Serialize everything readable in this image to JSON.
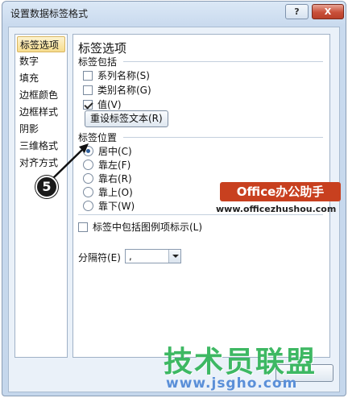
{
  "window": {
    "title": "设置数据标签格式",
    "help_label": "?",
    "close_label": "X"
  },
  "nav": {
    "items": [
      {
        "label": "标签选项",
        "selected": true
      },
      {
        "label": "数字"
      },
      {
        "label": "填充"
      },
      {
        "label": "边框颜色"
      },
      {
        "label": "边框样式"
      },
      {
        "label": "阴影"
      },
      {
        "label": "三维格式"
      },
      {
        "label": "对齐方式"
      }
    ]
  },
  "panel": {
    "title": "标签选项",
    "label_contains": {
      "heading": "标签包括",
      "options": [
        {
          "label": "系列名称(S)",
          "checked": false
        },
        {
          "label": "类别名称(G)",
          "checked": false
        },
        {
          "label": "值(V)",
          "checked": true
        }
      ],
      "reset_button": "重设标签文本(R)"
    },
    "label_position": {
      "heading": "标签位置",
      "options": [
        {
          "label": "居中(C)",
          "checked": true
        },
        {
          "label": "靠左(F)",
          "checked": false
        },
        {
          "label": "靠右(R)",
          "checked": false
        },
        {
          "label": "靠上(O)",
          "checked": false
        },
        {
          "label": "靠下(W)",
          "checked": false
        }
      ]
    },
    "include_legend_key": {
      "label": "标签中包括图例项标示(L)",
      "checked": false
    },
    "separator": {
      "label": "分隔符(E)",
      "value": ","
    }
  },
  "annotation": {
    "step_number": "5"
  },
  "watermark": {
    "brand": "Office办公助手",
    "brand_url": "www.officezhushou.com",
    "site_name": "技术员联盟",
    "site_url": "www.jsgho.com"
  }
}
